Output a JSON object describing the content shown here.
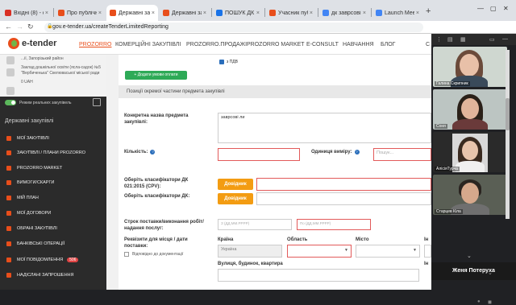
{
  "browser": {
    "tabs": [
      {
        "label": "Вхідні (8) - о",
        "favicon_color": "#d93025",
        "active": false
      },
      {
        "label": "Про публічні",
        "favicon_color": "#e84e1b",
        "active": false
      },
      {
        "label": "Державні за",
        "favicon_color": "#e84e1b",
        "active": true
      },
      {
        "label": "Державні за",
        "favicon_color": "#e84e1b",
        "active": false
      },
      {
        "label": "ПОШУК ДК 0",
        "favicon_color": "#1a73e8",
        "active": false
      },
      {
        "label": "Учасник пуб",
        "favicon_color": "#e84e1b",
        "active": false
      },
      {
        "label": "дк заврсові",
        "favicon_color": "#4285f4",
        "active": false
      },
      {
        "label": "Launch Meeti",
        "favicon_color": "#4285f4",
        "active": false
      }
    ],
    "url": "gov.e-tender.ua/createTenderLimitedReporting"
  },
  "header": {
    "logo_text": "e-tender",
    "menu": [
      {
        "label": "PROZORRO",
        "highlight": true
      },
      {
        "label": "КОМЕРЦІЙНІ ЗАКУПІВЛІ",
        "highlight": false
      },
      {
        "label": "PROZORRO.ПРОДАЖІ",
        "highlight": false
      },
      {
        "label": "PROZORRO MARKET",
        "highlight": false
      },
      {
        "label": "E-CONSULT",
        "highlight": false
      },
      {
        "label": "НАВЧАННЯ",
        "highlight": false
      },
      {
        "label": "БЛОГ",
        "highlight": false
      },
      {
        "label": "С",
        "highlight": false
      }
    ]
  },
  "sidebar": {
    "org_line1": "...ії, Запорізький район",
    "org_line2": "Заклад дошкільної освіти (ясла-садок) №5 \"Вербиченька\" Скелюваської міської ради",
    "org_line3": "0 UAH",
    "toggle_label": "Режим реальних закупівель",
    "section_title": "Державні закупівлі",
    "items": [
      {
        "label": "МОЇ ЗАКУПІВЛІ"
      },
      {
        "label": "ЗАКУПІВЛІ / ПЛАНИ PROZORRO"
      },
      {
        "label": "PROZORRO MARKET"
      },
      {
        "label": "ВИМОГИ/СКАРГИ"
      },
      {
        "label": "МІЙ ПЛАН"
      },
      {
        "label": "МОЇ ДОГОВОРИ"
      },
      {
        "label": "ОБРАНІ ЗАКУПІВЛІ"
      },
      {
        "label": "БАНКІВСЬКІ ОПЕРАЦІЇ"
      },
      {
        "label": "МОЇ ПОВІДОМЛЕННЯ",
        "badge": "506"
      },
      {
        "label": "НАДІСЛАНІ ЗАПРОШЕННЯ"
      }
    ]
  },
  "form": {
    "pdv_label": "з ПДВ",
    "add_payment_button": "+ Додати умови оплати",
    "section_header": "Позиції окремої частини предмета закупівлі",
    "item_name_label": "Конкретна назва предмета закупівлі:",
    "item_name_value": "заврсові ли",
    "quantity_label": "Кількість:",
    "unit_label": "Одиниця виміру:",
    "unit_placeholder": "Пошук...",
    "classifier_dk_label": "Оберіть класифікатори ДК 021:2015 (CPV):",
    "classifier_dk2_label": "Оберіть класифікатори ДК:",
    "directory_button": "Довідник",
    "delivery_term_label": "Строк поставки/виконання робіт/надання послуг:",
    "date_from_placeholder": "З (ДД.ММ.РРРР)",
    "date_to_placeholder": "По (ДД.ММ.РРРР)",
    "address_details_label": "Реквізити для місця / дати поставки:",
    "according_docs_label": "Відповідно до документації",
    "country_label": "Країна",
    "country_value": "Україна",
    "region_label": "Область",
    "city_label": "Місто",
    "index_label": "Ін",
    "street_label": "Вулиця, будинок, квартира",
    "index2_label": "Ін"
  },
  "video": {
    "participants": [
      {
        "name": "Галина Скрипник"
      },
      {
        "name": "Соня"
      },
      {
        "name": "АлісіяТурча"
      },
      {
        "name": "Старцев Кіла"
      }
    ],
    "speaker": "Женя Потеруха"
  }
}
